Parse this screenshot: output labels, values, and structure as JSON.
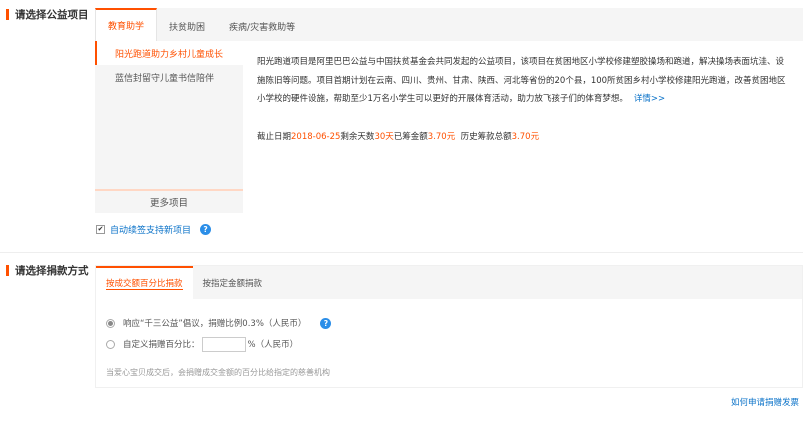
{
  "section1": {
    "title": "请选择公益项目"
  },
  "project_tabs": [
    {
      "label": "教育助学",
      "active": true
    },
    {
      "label": "扶贫助困",
      "active": false
    },
    {
      "label": "疾病/灾害救助等",
      "active": false
    }
  ],
  "project_list": [
    {
      "label": "阳光跑道助力乡村儿童成长",
      "active": true
    },
    {
      "label": "蓝信封留守儿童书信陪伴",
      "active": false
    }
  ],
  "more_projects": "更多项目",
  "description": "阳光跑道项目是阿里巴巴公益与中国扶贫基金会共同发起的公益项目，该项目在贫困地区小学校修建塑胶操场和跑道，解决操场表面坑洼、设施陈旧等问题。项目首期计划在云南、四川、贵州、甘肃、陕西、河北等省份的20个县，100所贫困乡村小学校修建阳光跑道，改善贫困地区小学校的硬件设施，帮助至少1万名小学生可以更好的开展体育活动，助力放飞孩子们的体育梦想。",
  "details_link": "详情>>",
  "deadline": {
    "label": "截止日期",
    "date": "2018-06-25",
    "remaining_label": "剩余天数",
    "remaining": "30天",
    "raised_label": "已筹金额",
    "raised": "3.70元",
    "history_label": "历史筹款总额",
    "history": "3.70元"
  },
  "auto_renew": {
    "label": "自动续签支持新项目",
    "checked": true,
    "help": "?"
  },
  "section2": {
    "title": "请选择捐款方式"
  },
  "donation_tabs": [
    {
      "label": "按成交额百分比捐款",
      "active": true
    },
    {
      "label": "按指定金额捐款",
      "active": false
    }
  ],
  "donation_options": {
    "option1": "响应“千三公益”倡议，捐赠比例0.3%（人民币）",
    "option1_help": "?",
    "option2_prefix": "自定义捐赠百分比：",
    "option2_value": "",
    "option2_suffix": "%（人民币）"
  },
  "donation_note": "当爱心宝贝成交后，会捐赠成交金额的百分比给指定的慈善机构",
  "apply_link": "如何申请捐赠发票",
  "colors": {
    "accent": "#ff5000",
    "link": "#0a72c8",
    "help": "#2b8ee8"
  }
}
